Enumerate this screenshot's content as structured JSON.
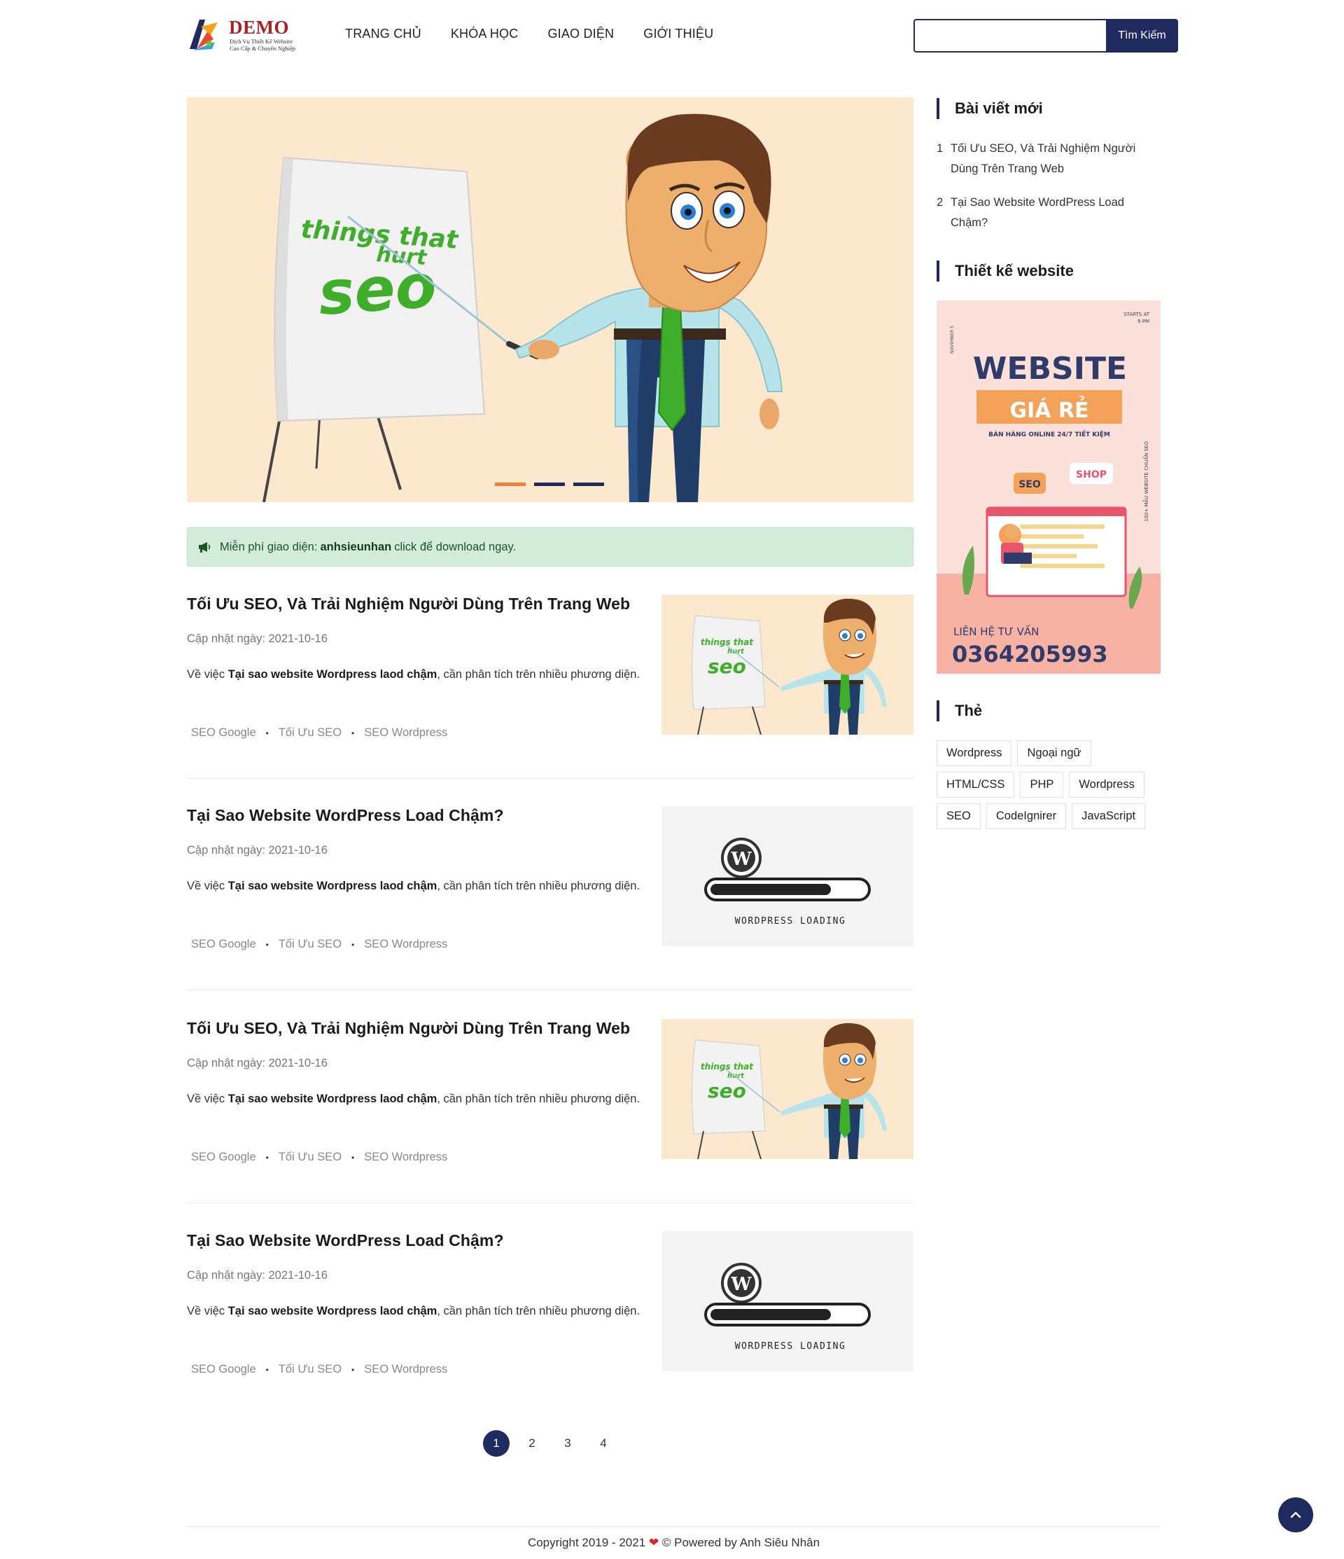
{
  "header": {
    "logo": {
      "brand": "DEMO",
      "tagline_1": "Dịch Vụ Thiết Kế Website",
      "tagline_2": "Cao Cấp & Chuyên Nghiệp"
    },
    "nav": [
      "TRANG CHỦ",
      "KHÓA HỌC",
      "GIAO DIỆN",
      "GIỚI THIỆU"
    ],
    "search": {
      "value": "",
      "placeholder": "",
      "button_label": "Tìm Kiếm"
    }
  },
  "hero": {
    "art_text": [
      "things that",
      "hurt",
      "seo"
    ],
    "slides": 3,
    "active_slide": 1,
    "colors": {
      "background": "#fce8cd",
      "accent": "#ef7f3f",
      "navy": "#1f2a5e"
    }
  },
  "notice": {
    "icon": "megaphone-icon",
    "prefix": "Miễn phí giao diện:",
    "link": "anhsieunhan",
    "suffix": "click để download ngay."
  },
  "posts": [
    {
      "title": "Tối Ưu SEO, Và Trải Nghiệm Người Dùng Trên Trang Web",
      "date": "Cập nhật ngày: 2021-10-16",
      "excerpt_prefix": "Về việc",
      "excerpt_bold": "Tại sao website Wordpress laod chậm",
      "excerpt_suffix": ", cần phân tích trên nhiều phương diện.",
      "tags": [
        "SEO Google",
        "Tối Ưu SEO",
        "SEO Wordpress"
      ],
      "thumb": "seo"
    },
    {
      "title": "Tại Sao Website WordPress Load Chậm?",
      "date": "Cập nhật ngày: 2021-10-16",
      "excerpt_prefix": "Về việc",
      "excerpt_bold": "Tại sao website Wordpress laod chậm",
      "excerpt_suffix": ", cần phân tích trên nhiều phương diện.",
      "tags": [
        "SEO Google",
        "Tối Ưu SEO",
        "SEO Wordpress"
      ],
      "thumb": "wp",
      "thumb_caption": "WORDPRESS LOADING"
    },
    {
      "title": "Tối Ưu SEO, Và Trải Nghiệm Người Dùng Trên Trang Web",
      "date": "Cập nhật ngày: 2021-10-16",
      "excerpt_prefix": "Về việc",
      "excerpt_bold": "Tại sao website Wordpress laod chậm",
      "excerpt_suffix": ", cần phân tích trên nhiều phương diện.",
      "tags": [
        "SEO Google",
        "Tối Ưu SEO",
        "SEO Wordpress"
      ],
      "thumb": "seo"
    },
    {
      "title": "Tại Sao Website WordPress Load Chậm?",
      "date": "Cập nhật ngày: 2021-10-16",
      "excerpt_prefix": "Về việc",
      "excerpt_bold": "Tại sao website Wordpress laod chậm",
      "excerpt_suffix": ", cần phân tích trên nhiều phương diện.",
      "tags": [
        "SEO Google",
        "Tối Ưu SEO",
        "SEO Wordpress"
      ],
      "thumb": "wp",
      "thumb_caption": "WORDPRESS LOADING"
    }
  ],
  "pagination": {
    "pages": [
      "1",
      "2",
      "3",
      "4"
    ],
    "current": "1"
  },
  "sidebar": {
    "recent": {
      "title": "Bài viết mới",
      "items": [
        {
          "num": "1",
          "text": "Tối Ưu SEO, Và Trải Nghiệm Người Dùng Trên Trang Web"
        },
        {
          "num": "2",
          "text": "Tại Sao Website WordPress Load Chậm?"
        }
      ]
    },
    "banner": {
      "title": "Thiết kế website",
      "date_side": "NOVEMBER 5",
      "starts": "STARTS AT",
      "time": "9 PM",
      "headline": "WEBSITE",
      "ribbon": "GIÁ RẺ",
      "subline": "BÁN HÀNG ONLINE 24/7 TIẾT KIỆM",
      "side_text": "100+ MẪU WEBSITE CHUẨN SEO",
      "bubble_seo": "SEO",
      "bubble_shop": "SHOP",
      "contact_label": "LIÊN HỆ TƯ VẤN",
      "phone": "0364205993"
    },
    "tags": {
      "title": "Thẻ",
      "items": [
        "Wordpress",
        "Ngoại ngữ",
        "HTML/CSS",
        "PHP",
        "Wordpress",
        "SEO",
        "CodeIgnirer",
        "JavaScript"
      ]
    }
  },
  "footer": {
    "prefix": "Copyright 2019 - 2021",
    "suffix": "© Powered by Anh Siêu Nhân"
  }
}
